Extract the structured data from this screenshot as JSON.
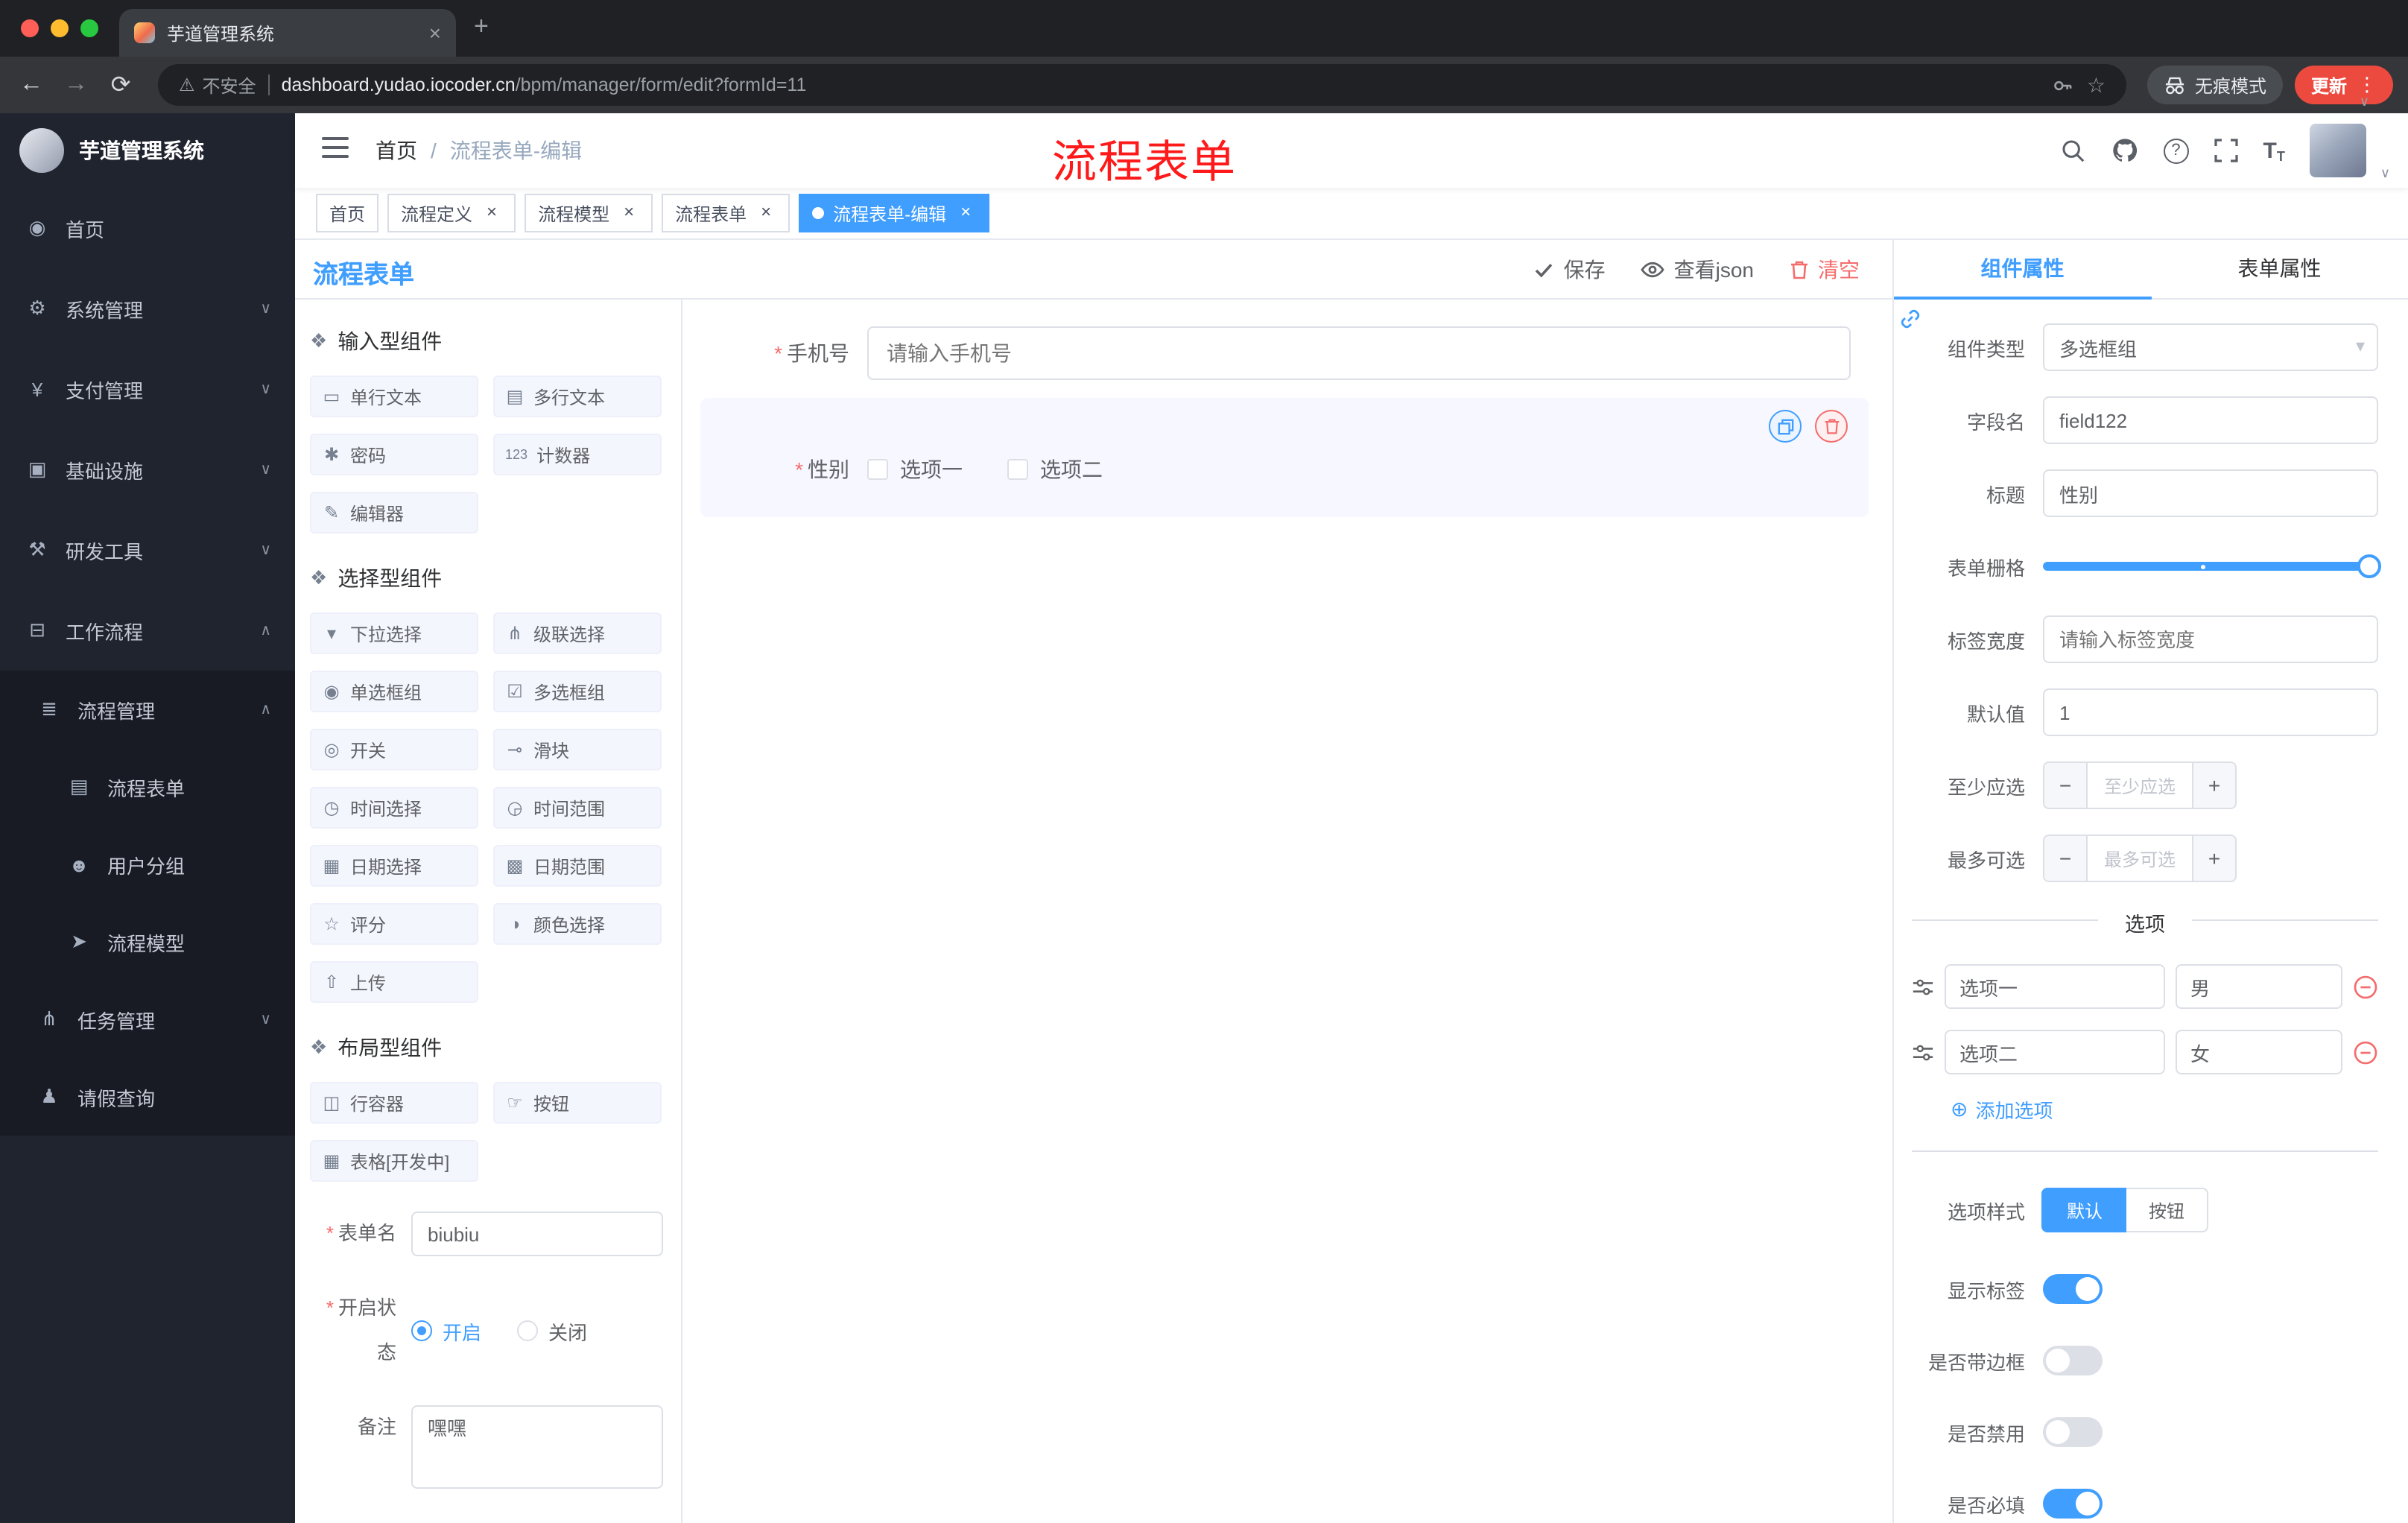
{
  "colors": {
    "accent": "#409eff",
    "danger": "#f56c6c",
    "sidebar_bg": "#20242e",
    "annotation_red": "#fe1a1a"
  },
  "browser": {
    "tab_title": "芋道管理系统",
    "security_label": "不安全",
    "url_host": "dashboard.yudao.iocoder.cn",
    "url_path": "/bpm/manager/form/edit?formId=11",
    "incognito_label": "无痕模式",
    "update_label": "更新"
  },
  "sidebar": {
    "logo_title": "芋道管理系统",
    "items": [
      {
        "icon": "home",
        "label": "首页"
      },
      {
        "icon": "gear",
        "label": "系统管理",
        "expand": "down"
      },
      {
        "icon": "yen",
        "label": "支付管理",
        "expand": "down"
      },
      {
        "icon": "monitor",
        "label": "基础设施",
        "expand": "down"
      },
      {
        "icon": "tools",
        "label": "研发工具",
        "expand": "down"
      },
      {
        "icon": "briefcase",
        "label": "工作流程",
        "expand": "up"
      }
    ],
    "submenu": [
      {
        "icon": "list",
        "label": "流程管理",
        "expand": "up"
      },
      {
        "icon": "document",
        "label": "流程表单",
        "active": true
      },
      {
        "icon": "users",
        "label": "用户分组"
      },
      {
        "icon": "send",
        "label": "流程模型"
      },
      {
        "icon": "tree",
        "label": "任务管理",
        "expand": "down"
      },
      {
        "icon": "user",
        "label": "请假查询"
      }
    ]
  },
  "header": {
    "breadcrumb": [
      "首页",
      "流程表单-编辑"
    ],
    "annotation": "流程表单"
  },
  "tags": [
    {
      "label": "首页",
      "closable": false,
      "active": false
    },
    {
      "label": "流程定义",
      "closable": true,
      "active": false
    },
    {
      "label": "流程模型",
      "closable": true,
      "active": false
    },
    {
      "label": "流程表单",
      "closable": true,
      "active": false
    },
    {
      "label": "流程表单-编辑",
      "closable": true,
      "active": true
    }
  ],
  "designer": {
    "title": "流程表单",
    "actions": {
      "save": "保存",
      "view_json": "查看json",
      "clear": "清空"
    },
    "palette": {
      "groups": [
        {
          "title": "输入型组件",
          "items": [
            {
              "icon": "text-field",
              "label": "单行文本"
            },
            {
              "icon": "textarea",
              "label": "多行文本"
            },
            {
              "icon": "password",
              "label": "密码"
            },
            {
              "icon": "counter",
              "label": "计数器"
            },
            {
              "icon": "editor",
              "label": "编辑器"
            }
          ]
        },
        {
          "title": "选择型组件",
          "items": [
            {
              "icon": "select",
              "label": "下拉选择"
            },
            {
              "icon": "cascader",
              "label": "级联选择"
            },
            {
              "icon": "radio-group",
              "label": "单选框组"
            },
            {
              "icon": "checkbox-group",
              "label": "多选框组"
            },
            {
              "icon": "switch",
              "label": "开关"
            },
            {
              "icon": "slider",
              "label": "滑块"
            },
            {
              "icon": "time-picker",
              "label": "时间选择"
            },
            {
              "icon": "time-range",
              "label": "时间范围"
            },
            {
              "icon": "date-picker",
              "label": "日期选择"
            },
            {
              "icon": "date-range",
              "label": "日期范围"
            },
            {
              "icon": "rate",
              "label": "评分"
            },
            {
              "icon": "color-picker",
              "label": "颜色选择"
            },
            {
              "icon": "upload",
              "label": "上传"
            }
          ]
        },
        {
          "title": "布局型组件",
          "items": [
            {
              "icon": "row-container",
              "label": "行容器"
            },
            {
              "icon": "button",
              "label": "按钮"
            },
            {
              "icon": "table",
              "label": "表格[开发中]"
            }
          ]
        }
      ]
    },
    "meta": {
      "form_name": {
        "label": "表单名",
        "value": "biubiu"
      },
      "status": {
        "label": "开启状态",
        "options": [
          "开启",
          "关闭"
        ],
        "selected": "开启"
      },
      "remark": {
        "label": "备注",
        "value": "嘿嘿"
      }
    },
    "canvas": {
      "phone": {
        "label": "手机号",
        "placeholder": "请输入手机号"
      },
      "gender": {
        "label": "性别",
        "options": [
          "选项一",
          "选项二"
        ]
      }
    }
  },
  "props": {
    "tabs": [
      "组件属性",
      "表单属性"
    ],
    "active_tab": "组件属性",
    "component_type": {
      "label": "组件类型",
      "value": "多选框组"
    },
    "field_name": {
      "label": "字段名",
      "value": "field122"
    },
    "title": {
      "label": "标题",
      "value": "性别"
    },
    "grid": {
      "label": "表单栅格"
    },
    "label_width": {
      "label": "标签宽度",
      "placeholder": "请输入标签宽度"
    },
    "default_value": {
      "label": "默认值",
      "value": "1"
    },
    "min_select": {
      "label": "至少应选",
      "placeholder": "至少应选"
    },
    "max_select": {
      "label": "最多可选",
      "placeholder": "最多可选"
    },
    "options_title": "选项",
    "options": [
      {
        "label": "选项一",
        "value": "男"
      },
      {
        "label": "选项二",
        "value": "女"
      }
    ],
    "add_option": "添加选项",
    "option_style": {
      "label": "选项样式",
      "options": [
        "默认",
        "按钮"
      ],
      "selected": "默认"
    },
    "toggles": [
      {
        "label": "显示标签",
        "on": true
      },
      {
        "label": "是否带边框",
        "on": false
      },
      {
        "label": "是否禁用",
        "on": false
      },
      {
        "label": "是否必填",
        "on": true
      }
    ]
  }
}
